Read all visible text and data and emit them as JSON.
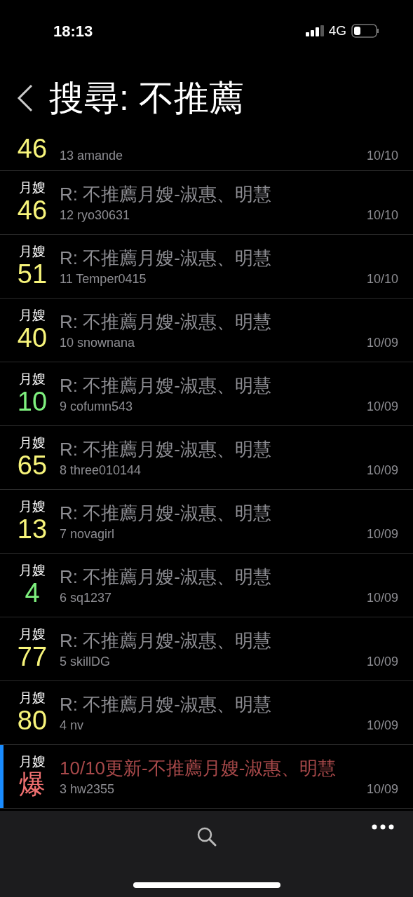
{
  "status_bar": {
    "time": "18:13",
    "network": "4G"
  },
  "header": {
    "title": "搜尋: 不推薦"
  },
  "posts": [
    {
      "kind": "partial",
      "count": "46",
      "color": "#f7f47a",
      "author_line": "13 amande",
      "date": "10/10",
      "marked": false
    },
    {
      "kind": "full",
      "category": "月嫂",
      "count": "46",
      "color": "#f7f47a",
      "title": "R: 不推薦月嫂-淑惠、明慧",
      "author_line": "12 ryo30631",
      "date": "10/10",
      "marked": false
    },
    {
      "kind": "full",
      "category": "月嫂",
      "count": "51",
      "color": "#f7f47a",
      "title": "R: 不推薦月嫂-淑惠、明慧",
      "author_line": "11 Temper0415",
      "date": "10/10",
      "marked": false
    },
    {
      "kind": "full",
      "category": "月嫂",
      "count": "40",
      "color": "#f7f47a",
      "title": "R: 不推薦月嫂-淑惠、明慧",
      "author_line": "10 snownana",
      "date": "10/09",
      "marked": false
    },
    {
      "kind": "full",
      "category": "月嫂",
      "count": "10",
      "color": "#7ef07e",
      "title": "R: 不推薦月嫂-淑惠、明慧",
      "author_line": "9 cofumn543",
      "date": "10/09",
      "marked": false
    },
    {
      "kind": "full",
      "category": "月嫂",
      "count": "65",
      "color": "#f7f47a",
      "title": "R: 不推薦月嫂-淑惠、明慧",
      "author_line": "8 three010144",
      "date": "10/09",
      "marked": false
    },
    {
      "kind": "full",
      "category": "月嫂",
      "count": "13",
      "color": "#f7f47a",
      "title": "R: 不推薦月嫂-淑惠、明慧",
      "author_line": "7 novagirl",
      "date": "10/09",
      "marked": false
    },
    {
      "kind": "full",
      "category": "月嫂",
      "count": "4",
      "color": "#7ef07e",
      "title": "R: 不推薦月嫂-淑惠、明慧",
      "author_line": "6 sq1237",
      "date": "10/09",
      "marked": false
    },
    {
      "kind": "full",
      "category": "月嫂",
      "count": "77",
      "color": "#f7f47a",
      "title": "R: 不推薦月嫂-淑惠、明慧",
      "author_line": "5 skillDG",
      "date": "10/09",
      "marked": false
    },
    {
      "kind": "full",
      "category": "月嫂",
      "count": "80",
      "color": "#f7f47a",
      "title": "R: 不推薦月嫂-淑惠、明慧",
      "author_line": "4 nv",
      "date": "10/09",
      "marked": false
    },
    {
      "kind": "full",
      "category": "月嫂",
      "count": "爆",
      "color": "#f07070",
      "title": "10/10更新-不推薦月嫂-淑惠、明慧",
      "author_line": "3 hw2355",
      "date": "10/09",
      "marked": true
    }
  ]
}
